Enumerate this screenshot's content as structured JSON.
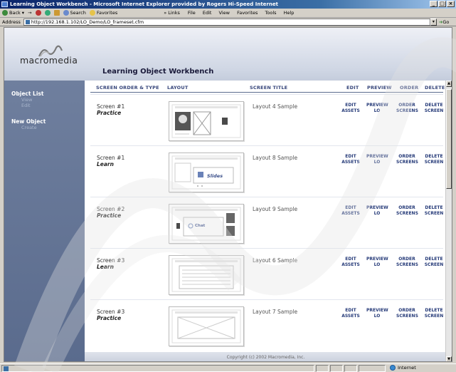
{
  "window": {
    "title": "Learning Object Workbench - Microsoft Internet Explorer provided by Rogers Hi-Speed Internet",
    "controls": [
      "_",
      "□",
      "×"
    ]
  },
  "toolbar": {
    "back": "Back",
    "search": "Search",
    "favorites": "Favorites",
    "links": "Links",
    "menu": [
      "File",
      "Edit",
      "View",
      "Favorites",
      "Tools",
      "Help"
    ]
  },
  "address": {
    "label": "Address",
    "url": "http://192.168.1.102/LO_Demo/LO_frameset.cfm",
    "go": "Go"
  },
  "brand": {
    "logo": "macromedia",
    "app_title": "Learning Object Workbench"
  },
  "sidebar": {
    "sections": [
      {
        "title": "Object List",
        "items": [
          "View",
          "Edit"
        ]
      },
      {
        "title": "New Object",
        "items": [
          "Create"
        ]
      }
    ]
  },
  "table": {
    "headers": {
      "order_type": "SCREEN ORDER & TYPE",
      "layout": "LAYOUT",
      "title": "SCREEN TITLE",
      "edit": "EDIT",
      "preview": "PREVIEW",
      "order": "ORDER",
      "delete": "DELETE"
    },
    "rows": [
      {
        "screen": "Screen #1",
        "type": "Practice",
        "title": "Layout 4 Sample",
        "layout": "layout4"
      },
      {
        "screen": "Screen #1",
        "type": "Learn",
        "title": "Layout 8 Sample",
        "layout": "layout8"
      },
      {
        "screen": "Screen #2",
        "type": "Practice",
        "title": "Layout 9 Sample",
        "layout": "layout9"
      },
      {
        "screen": "Screen #3",
        "type": "Learn",
        "title": "Layout 6 Sample",
        "layout": "layout6"
      },
      {
        "screen": "Screen #3",
        "type": "Practice",
        "title": "Layout 7 Sample",
        "layout": "layout7"
      }
    ],
    "actions": {
      "edit": [
        "EDIT",
        "ASSETS"
      ],
      "preview": [
        "PREVIEW",
        "LO"
      ],
      "order": [
        "ORDER",
        "SCREENS"
      ],
      "delete": [
        "DELETE",
        "SCREEN"
      ]
    },
    "thumb_labels": {
      "slides": "Slides",
      "chat": "Chat"
    }
  },
  "footer": {
    "copyright": "Copyright (c) 2002 Macromedia, Inc."
  },
  "status": {
    "zone": "Internet"
  }
}
